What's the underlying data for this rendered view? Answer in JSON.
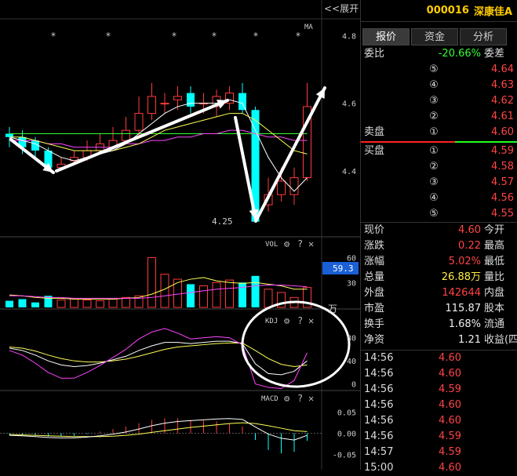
{
  "toolbar": {
    "collapse_label": "<<展开"
  },
  "stock": {
    "code": "000016",
    "name": "深康佳A"
  },
  "tabs": [
    {
      "label": "报价"
    },
    {
      "label": "资金"
    },
    {
      "label": "分析"
    }
  ],
  "order_ratio": {
    "label": "委比",
    "value": "-20.66%",
    "tail": "委差"
  },
  "asks": [
    {
      "idx": "⑤",
      "price": "4.64"
    },
    {
      "idx": "④",
      "price": "4.63"
    },
    {
      "idx": "③",
      "price": "4.62"
    },
    {
      "idx": "②",
      "price": "4.61"
    },
    {
      "idx": "①",
      "price": "4.60",
      "label": "卖盘"
    }
  ],
  "bids": [
    {
      "idx": "①",
      "price": "4.59",
      "label": "买盘"
    },
    {
      "idx": "②",
      "price": "4.58"
    },
    {
      "idx": "③",
      "price": "4.57"
    },
    {
      "idx": "④",
      "price": "4.56"
    },
    {
      "idx": "⑤",
      "price": "4.55"
    }
  ],
  "stats": [
    {
      "label": "现价",
      "value": "4.60",
      "tail": "今开",
      "color": "red"
    },
    {
      "label": "涨跌",
      "value": "0.22",
      "tail": "最高",
      "color": "red"
    },
    {
      "label": "涨幅",
      "value": "5.02%",
      "tail": "最低",
      "color": "red"
    },
    {
      "label": "总量",
      "value": "26.88万",
      "tail": "量比",
      "color": "yellow"
    },
    {
      "label": "外盘",
      "value": "142644",
      "tail": "内盘",
      "color": "red"
    },
    {
      "label": "市盈",
      "value": "115.87",
      "tail": "股本",
      "color": "white"
    },
    {
      "label": "换手",
      "value": "1.68%",
      "tail": "流通",
      "color": "white"
    },
    {
      "label": "净资",
      "value": "1.21",
      "tail": "收益(四",
      "color": "white"
    }
  ],
  "ticks": [
    {
      "time": "14:56",
      "price": "4.60"
    },
    {
      "time": "14:56",
      "price": "4.60"
    },
    {
      "time": "14:56",
      "price": "4.59"
    },
    {
      "time": "14:56",
      "price": "4.60"
    },
    {
      "time": "14:56",
      "price": "4.60"
    },
    {
      "time": "14:56",
      "price": "4.59"
    },
    {
      "time": "14:57",
      "price": "4.59"
    },
    {
      "time": "15:00",
      "price": "4.60"
    }
  ],
  "indicators": {
    "ma_label": "MA",
    "vol_label": "VOL",
    "kdj_label": "KDJ",
    "macd_label": "MACD",
    "vol_value": "59.3",
    "vol_unit": "万",
    "low_mark": "4.25",
    "gear": "⚙",
    "help": "?",
    "close": "✕",
    "star": "*"
  },
  "axes": {
    "price": [
      "4.8",
      "4.6",
      "4.4"
    ],
    "vol": [
      "60",
      "30"
    ],
    "kdj": [
      "80",
      "40",
      "0"
    ],
    "macd": [
      "0.05",
      "0.00",
      "-0.05"
    ]
  },
  "colors": {
    "up": "#ff3b3b",
    "down": "#00ffff",
    "ma5": "#ffffff",
    "ma10": "#ffff55",
    "ma20": "#ff44ff",
    "ma60": "#33ff33",
    "annotation": "#ffffff"
  },
  "chart_data": {
    "type": "candlestick",
    "candles": [
      {
        "o": 4.51,
        "c": 4.5,
        "h": 4.53,
        "l": 4.47
      },
      {
        "o": 4.5,
        "c": 4.47,
        "h": 4.52,
        "l": 4.45
      },
      {
        "o": 4.49,
        "c": 4.46,
        "h": 4.5,
        "l": 4.44
      },
      {
        "o": 4.46,
        "c": 4.41,
        "h": 4.47,
        "l": 4.4
      },
      {
        "o": 4.41,
        "c": 4.42,
        "h": 4.44,
        "l": 4.4
      },
      {
        "o": 4.43,
        "c": 4.44,
        "h": 4.46,
        "l": 4.42
      },
      {
        "o": 4.44,
        "c": 4.46,
        "h": 4.49,
        "l": 4.43
      },
      {
        "o": 4.46,
        "c": 4.48,
        "h": 4.51,
        "l": 4.45
      },
      {
        "o": 4.47,
        "c": 4.49,
        "h": 4.53,
        "l": 4.46
      },
      {
        "o": 4.49,
        "c": 4.52,
        "h": 4.56,
        "l": 4.48
      },
      {
        "o": 4.52,
        "c": 4.57,
        "h": 4.62,
        "l": 4.5
      },
      {
        "o": 4.57,
        "c": 4.62,
        "h": 4.66,
        "l": 4.55
      },
      {
        "o": 4.6,
        "c": 4.6,
        "h": 4.63,
        "l": 4.57
      },
      {
        "o": 4.61,
        "c": 4.62,
        "h": 4.65,
        "l": 4.58
      },
      {
        "o": 4.63,
        "c": 4.59,
        "h": 4.65,
        "l": 4.57
      },
      {
        "o": 4.6,
        "c": 4.6,
        "h": 4.63,
        "l": 4.57
      },
      {
        "o": 4.59,
        "c": 4.62,
        "h": 4.64,
        "l": 4.56
      },
      {
        "o": 4.6,
        "c": 4.63,
        "h": 4.65,
        "l": 4.58
      },
      {
        "o": 4.63,
        "c": 4.58,
        "h": 4.66,
        "l": 4.57
      },
      {
        "o": 4.58,
        "c": 4.25,
        "h": 4.59,
        "l": 4.25
      },
      {
        "o": 4.3,
        "c": 4.33,
        "h": 4.38,
        "l": 4.28
      },
      {
        "o": 4.33,
        "c": 4.37,
        "h": 4.41,
        "l": 4.31
      },
      {
        "o": 4.33,
        "c": 4.38,
        "h": 4.41,
        "l": 4.3
      },
      {
        "o": 4.38,
        "c": 4.59,
        "h": 4.66,
        "l": 4.37
      }
    ],
    "ma5": [
      4.5,
      4.49,
      4.48,
      4.46,
      4.44,
      4.43,
      4.44,
      4.45,
      4.46,
      4.48,
      4.51,
      4.54,
      4.57,
      4.59,
      4.6,
      4.6,
      4.6,
      4.61,
      4.6,
      4.52,
      4.44,
      4.38,
      4.34,
      4.38
    ],
    "ma10": [
      4.5,
      4.5,
      4.49,
      4.48,
      4.47,
      4.46,
      4.46,
      4.46,
      4.46,
      4.47,
      4.48,
      4.5,
      4.52,
      4.53,
      4.54,
      4.55,
      4.56,
      4.57,
      4.57,
      4.55,
      4.52,
      4.49,
      4.46,
      4.45
    ],
    "ma20": [
      4.49,
      4.49,
      4.49,
      4.48,
      4.48,
      4.47,
      4.47,
      4.47,
      4.47,
      4.48,
      4.48,
      4.49,
      4.49,
      4.5,
      4.5,
      4.51,
      4.51,
      4.52,
      4.52,
      4.51,
      4.5,
      4.5,
      4.49,
      4.49
    ],
    "ma60": [
      4.51,
      4.51,
      4.51,
      4.51,
      4.51,
      4.51,
      4.51,
      4.51,
      4.51,
      4.51,
      4.51,
      4.51,
      4.51,
      4.51,
      4.51,
      4.51,
      4.51,
      4.51,
      4.51,
      4.51,
      4.51,
      4.51,
      4.51,
      4.51
    ],
    "price_range": [
      4.21,
      4.84
    ],
    "volume": [
      8,
      10,
      6,
      14,
      9,
      10,
      9,
      8,
      10,
      12,
      14,
      60,
      40,
      34,
      28,
      26,
      30,
      33,
      30,
      38,
      22,
      18,
      12,
      24
    ],
    "vol_ma": [
      15,
      14,
      12,
      11,
      11,
      10,
      10,
      10,
      10,
      11,
      12,
      16,
      22,
      30,
      34,
      36,
      32,
      30,
      29,
      30,
      28,
      26,
      22,
      22
    ],
    "vol_ma2": [
      14,
      14,
      13,
      12,
      12,
      11,
      11,
      11,
      11,
      11,
      11,
      12,
      14,
      16,
      18,
      20,
      22,
      23,
      24,
      26,
      27,
      27,
      26,
      25
    ],
    "vol_range": [
      0,
      70
    ],
    "kdj_k": [
      62,
      58,
      50,
      40,
      33,
      30,
      32,
      36,
      42,
      48,
      58,
      66,
      72,
      72,
      70,
      72,
      74,
      74,
      70,
      35,
      18,
      16,
      22,
      40
    ],
    "kdj_d": [
      64,
      62,
      57,
      50,
      44,
      40,
      38,
      38,
      40,
      43,
      48,
      54,
      60,
      64,
      66,
      68,
      70,
      71,
      71,
      58,
      44,
      34,
      30,
      33
    ],
    "kdj_j": [
      58,
      50,
      36,
      20,
      10,
      10,
      20,
      32,
      46,
      60,
      78,
      90,
      96,
      88,
      78,
      80,
      82,
      80,
      68,
      0,
      -6,
      -8,
      6,
      54
    ],
    "kdj_range": [
      -10,
      100
    ],
    "macd_dif": [
      -0.005,
      -0.006,
      -0.008,
      -0.01,
      -0.011,
      -0.011,
      -0.009,
      -0.006,
      -0.002,
      0.003,
      0.01,
      0.018,
      0.024,
      0.028,
      0.03,
      0.032,
      0.034,
      0.035,
      0.033,
      0.015,
      -0.002,
      -0.012,
      -0.016,
      -0.005
    ],
    "macd_dea": [
      -0.003,
      -0.004,
      -0.005,
      -0.006,
      -0.007,
      -0.008,
      -0.008,
      -0.008,
      -0.007,
      -0.005,
      -0.002,
      0.002,
      0.006,
      0.01,
      0.014,
      0.017,
      0.02,
      0.023,
      0.025,
      0.023,
      0.018,
      0.012,
      0.006,
      0.004
    ],
    "macd_range": [
      -0.07,
      0.07
    ]
  }
}
